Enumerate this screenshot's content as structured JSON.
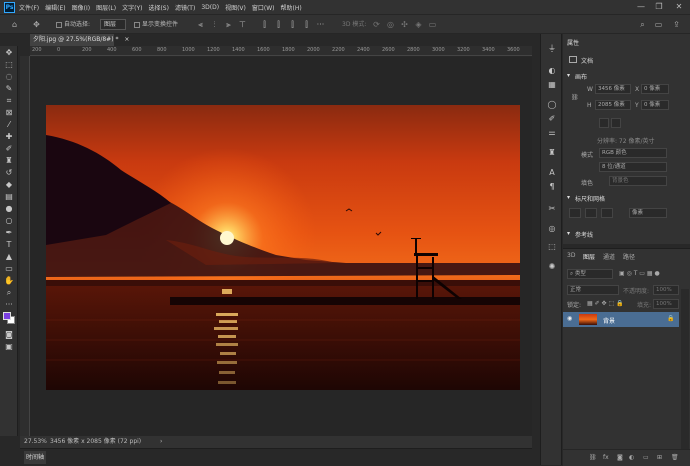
{
  "app": {
    "logo": "Ps"
  },
  "menu": [
    "文件(F)",
    "编辑(E)",
    "图像(I)",
    "图层(L)",
    "文字(Y)",
    "选择(S)",
    "滤镜(T)",
    "3D(D)",
    "视图(V)",
    "窗口(W)",
    "帮助(H)"
  ],
  "window_controls": {
    "minimize": "—",
    "restore": "❐",
    "close": "✕"
  },
  "options": {
    "auto_select_label": "自动选择:",
    "auto_select_value": "图层",
    "show_transform_label": "显示变换控件",
    "mode_3d_label": "3D 模式:",
    "more": "···"
  },
  "document_tab": {
    "title": "夕阳.jpg @ 27.5%(RGB/8#) *",
    "close": "×"
  },
  "ruler_ticks": [
    "200",
    "0",
    "200",
    "400",
    "600",
    "800",
    "1000",
    "1200",
    "1400",
    "1600",
    "1800",
    "2000",
    "2200",
    "2400",
    "2600",
    "2800",
    "3000",
    "3200",
    "3400",
    "3600"
  ],
  "status": {
    "zoom": "27.53%",
    "doc_info": "3456 像素 x 2085 像素 (72 ppi)",
    "arrow": "›"
  },
  "timeline": {
    "label": "时间轴"
  },
  "properties": {
    "header": "属性",
    "doc_label": "文档",
    "canvas_section": "画布",
    "w_label": "W",
    "w_value": "3456 像素",
    "h_label": "H",
    "h_value": "2085 像素",
    "x_label": "X",
    "x_value": "0 像素",
    "y_label": "Y",
    "y_value": "0 像素",
    "resolution": "分辨率: 72 像素/英寸",
    "mode_label": "模式",
    "mode_value": "RGB 颜色",
    "depth_value": "8 位/通道",
    "fill_label": "填色",
    "fill_value": "背景色",
    "rulers_section": "标尺和网格",
    "ruler_unit": "像素",
    "guides_section": "参考线"
  },
  "layers": {
    "tabs": [
      "3D",
      "图层",
      "通道",
      "路径"
    ],
    "filter_label": "类型",
    "blend_mode": "正常",
    "opacity_label": "不透明度:",
    "opacity_value": "100%",
    "lock_label": "锁定:",
    "fill_label": "填充:",
    "fill_value": "100%",
    "items": [
      {
        "name": "背景"
      }
    ],
    "footer_icons": [
      "link-icon",
      "fx-icon",
      "mask-icon",
      "adjustment-icon",
      "folder-icon",
      "new-layer-icon",
      "trash-icon"
    ]
  },
  "colors": {
    "foreground": "#7b3fe0",
    "background": "#ffffff",
    "accent": "#31a8ff"
  }
}
